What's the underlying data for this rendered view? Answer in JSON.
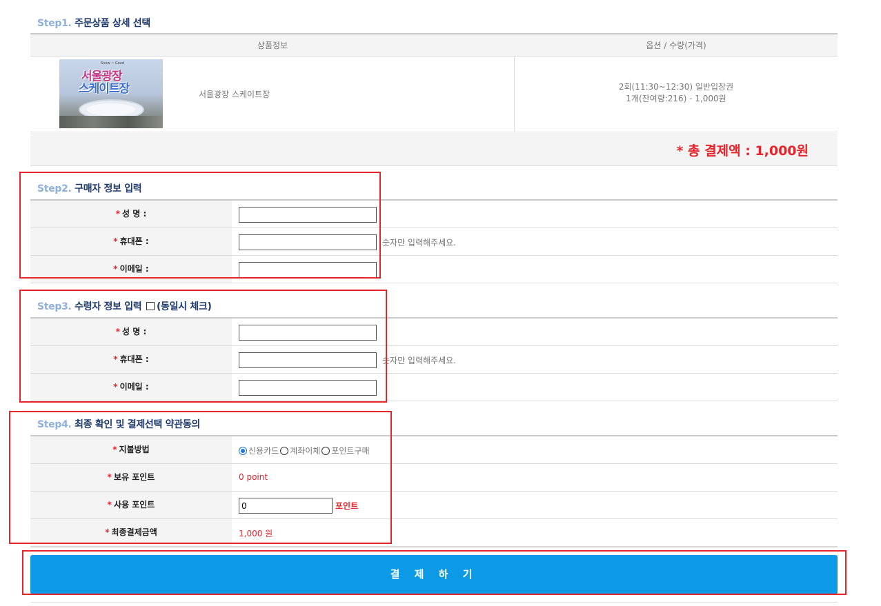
{
  "step1": {
    "num": "Step1.",
    "title": "주문상품 상세 선택",
    "col_product": "상품정보",
    "col_option": "옵션 / 수량(가격)",
    "product_name": "서울광장 스케이트장",
    "option_line1": "2회(11:30~12:30) 일반입장권",
    "option_line2": "1개(잔여량:216) - 1,000원",
    "total_label": "* 총 결제액 : 1,000원",
    "image": {
      "title_top": "서울광장",
      "title_bottom": "스케이트장"
    }
  },
  "step2": {
    "num": "Step2.",
    "title": "구매자 정보 입력",
    "name_label": "성  명 :",
    "phone_label": "휴대폰 :",
    "email_label": "이메일 :",
    "phone_hint": "숫자만 입력해주세요.",
    "name_value": "",
    "phone_value": "",
    "email_value": ""
  },
  "step3": {
    "num": "Step3.",
    "title": "수령자 정보 입력",
    "same_check_label": "(동일시 체크)",
    "name_label": "성  명 :",
    "phone_label": "휴대폰 :",
    "email_label": "이메일 :",
    "phone_hint": "숫자만 입력해주세요.",
    "name_value": "",
    "phone_value": "",
    "email_value": ""
  },
  "step4": {
    "num": "Step4.",
    "title": "최종 확인 및 결제선택 약관동의",
    "pay_method_label": "지불방법",
    "pay_methods": [
      "신용카드",
      "계좌이체",
      "포인트구매"
    ],
    "pay_method_selected": "신용카드",
    "own_point_label": "보유 포인트",
    "own_point_value": "0 point",
    "use_point_label": "사용 포인트",
    "use_point_value": "0",
    "use_point_unit": "포인트",
    "final_amount_label": "최종결제금액",
    "final_amount_value": "1,000 원"
  },
  "pay_button": "결 제 하 기",
  "colors": {
    "accent": "#0c9ae6",
    "required": "#e8232a",
    "annotation": "#e8232a",
    "step_title": "#1e3a6e"
  }
}
